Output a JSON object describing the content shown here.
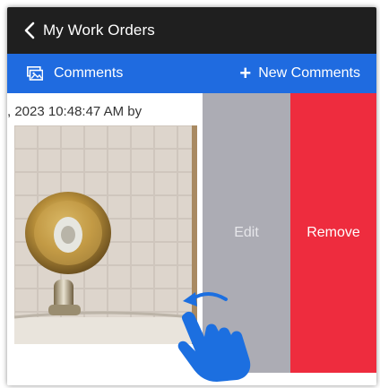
{
  "nav": {
    "back_icon": "chevron-left-icon",
    "title": "My Work Orders"
  },
  "toolbar": {
    "comments_icon": "photo-comments-icon",
    "comments_label": "Comments",
    "new_icon": "plus-icon",
    "new_plus": "+",
    "new_label": "New Comments"
  },
  "comment": {
    "timestamp": ", 2023 10:48:47 AM by",
    "photo_icon": "bathroom-photo"
  },
  "swipe_actions": {
    "edit_label": "Edit",
    "remove_label": "Remove"
  },
  "gesture_hint": {
    "icon": "swipe-left-hand-icon"
  },
  "colors": {
    "navbar": "#1f1f1f",
    "toolbar": "#1f6be0",
    "edit": "#acacb4",
    "remove": "#ee2c3e",
    "hand": "#1c6fe0"
  }
}
